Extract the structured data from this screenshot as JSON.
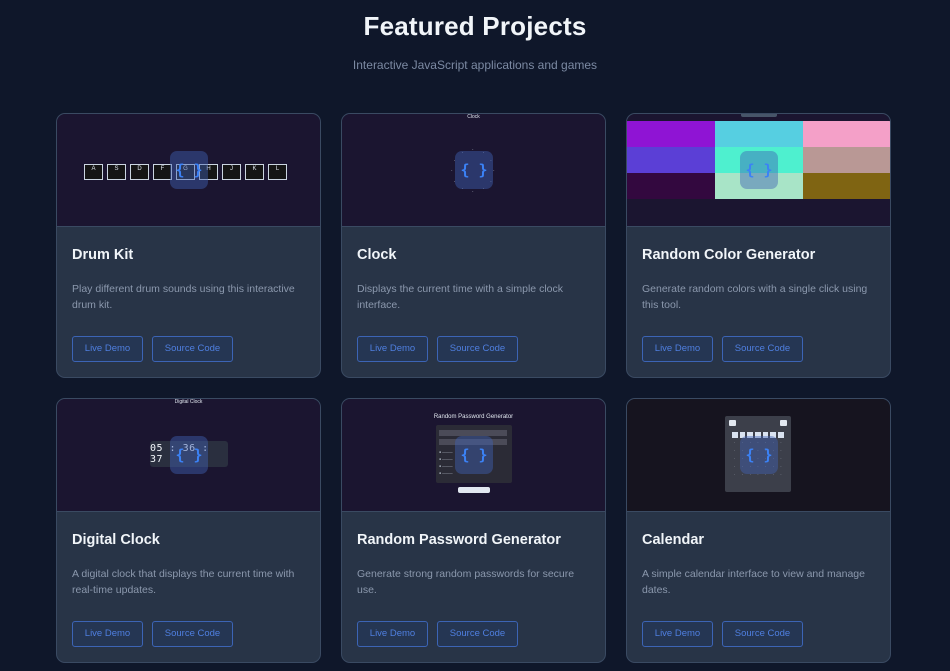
{
  "page": {
    "title": "Featured Projects",
    "subtitle": "Interactive JavaScript applications and games"
  },
  "colors": {
    "background": "#0f172a",
    "card": "#283447",
    "preview": "#1b1530",
    "accent": "#3b82f6"
  },
  "code_badge": "{ }",
  "projects": [
    {
      "title": "Drum Kit",
      "description": "Play different drum sounds using this interactive drum kit.",
      "live_label": "Live Demo",
      "source_label": "Source Code",
      "keys": [
        "A",
        "S",
        "D",
        "F",
        "G",
        "H",
        "J",
        "K",
        "L"
      ]
    },
    {
      "title": "Clock",
      "description": "Displays the current time with a simple clock interface.",
      "live_label": "Live Demo",
      "source_label": "Source Code",
      "preview_label": "Clock"
    },
    {
      "title": "Random Color Generator",
      "description": "Generate random colors with a single click using this tool.",
      "live_label": "Live Demo",
      "source_label": "Source Code",
      "swatches": [
        "#8f14d4",
        "#56cfe1",
        "#f4a0c8",
        "#5b3fd6",
        "#4ef0cf",
        "#b99895",
        "#33083f",
        "#a8e4c7",
        "#7f6412"
      ]
    },
    {
      "title": "Digital Clock",
      "description": "A digital clock that displays the current time with real-time updates.",
      "live_label": "Live Demo",
      "source_label": "Source Code",
      "preview_label": "Digital Clock",
      "time": "05 : 36 : 37"
    },
    {
      "title": "Random Password Generator",
      "description": "Generate strong random passwords for secure use.",
      "live_label": "Live Demo",
      "source_label": "Source Code",
      "preview_label": "Random Password Generator"
    },
    {
      "title": "Calendar",
      "description": "A simple calendar interface to view and manage dates.",
      "live_label": "Live Demo",
      "source_label": "Source Code"
    }
  ]
}
